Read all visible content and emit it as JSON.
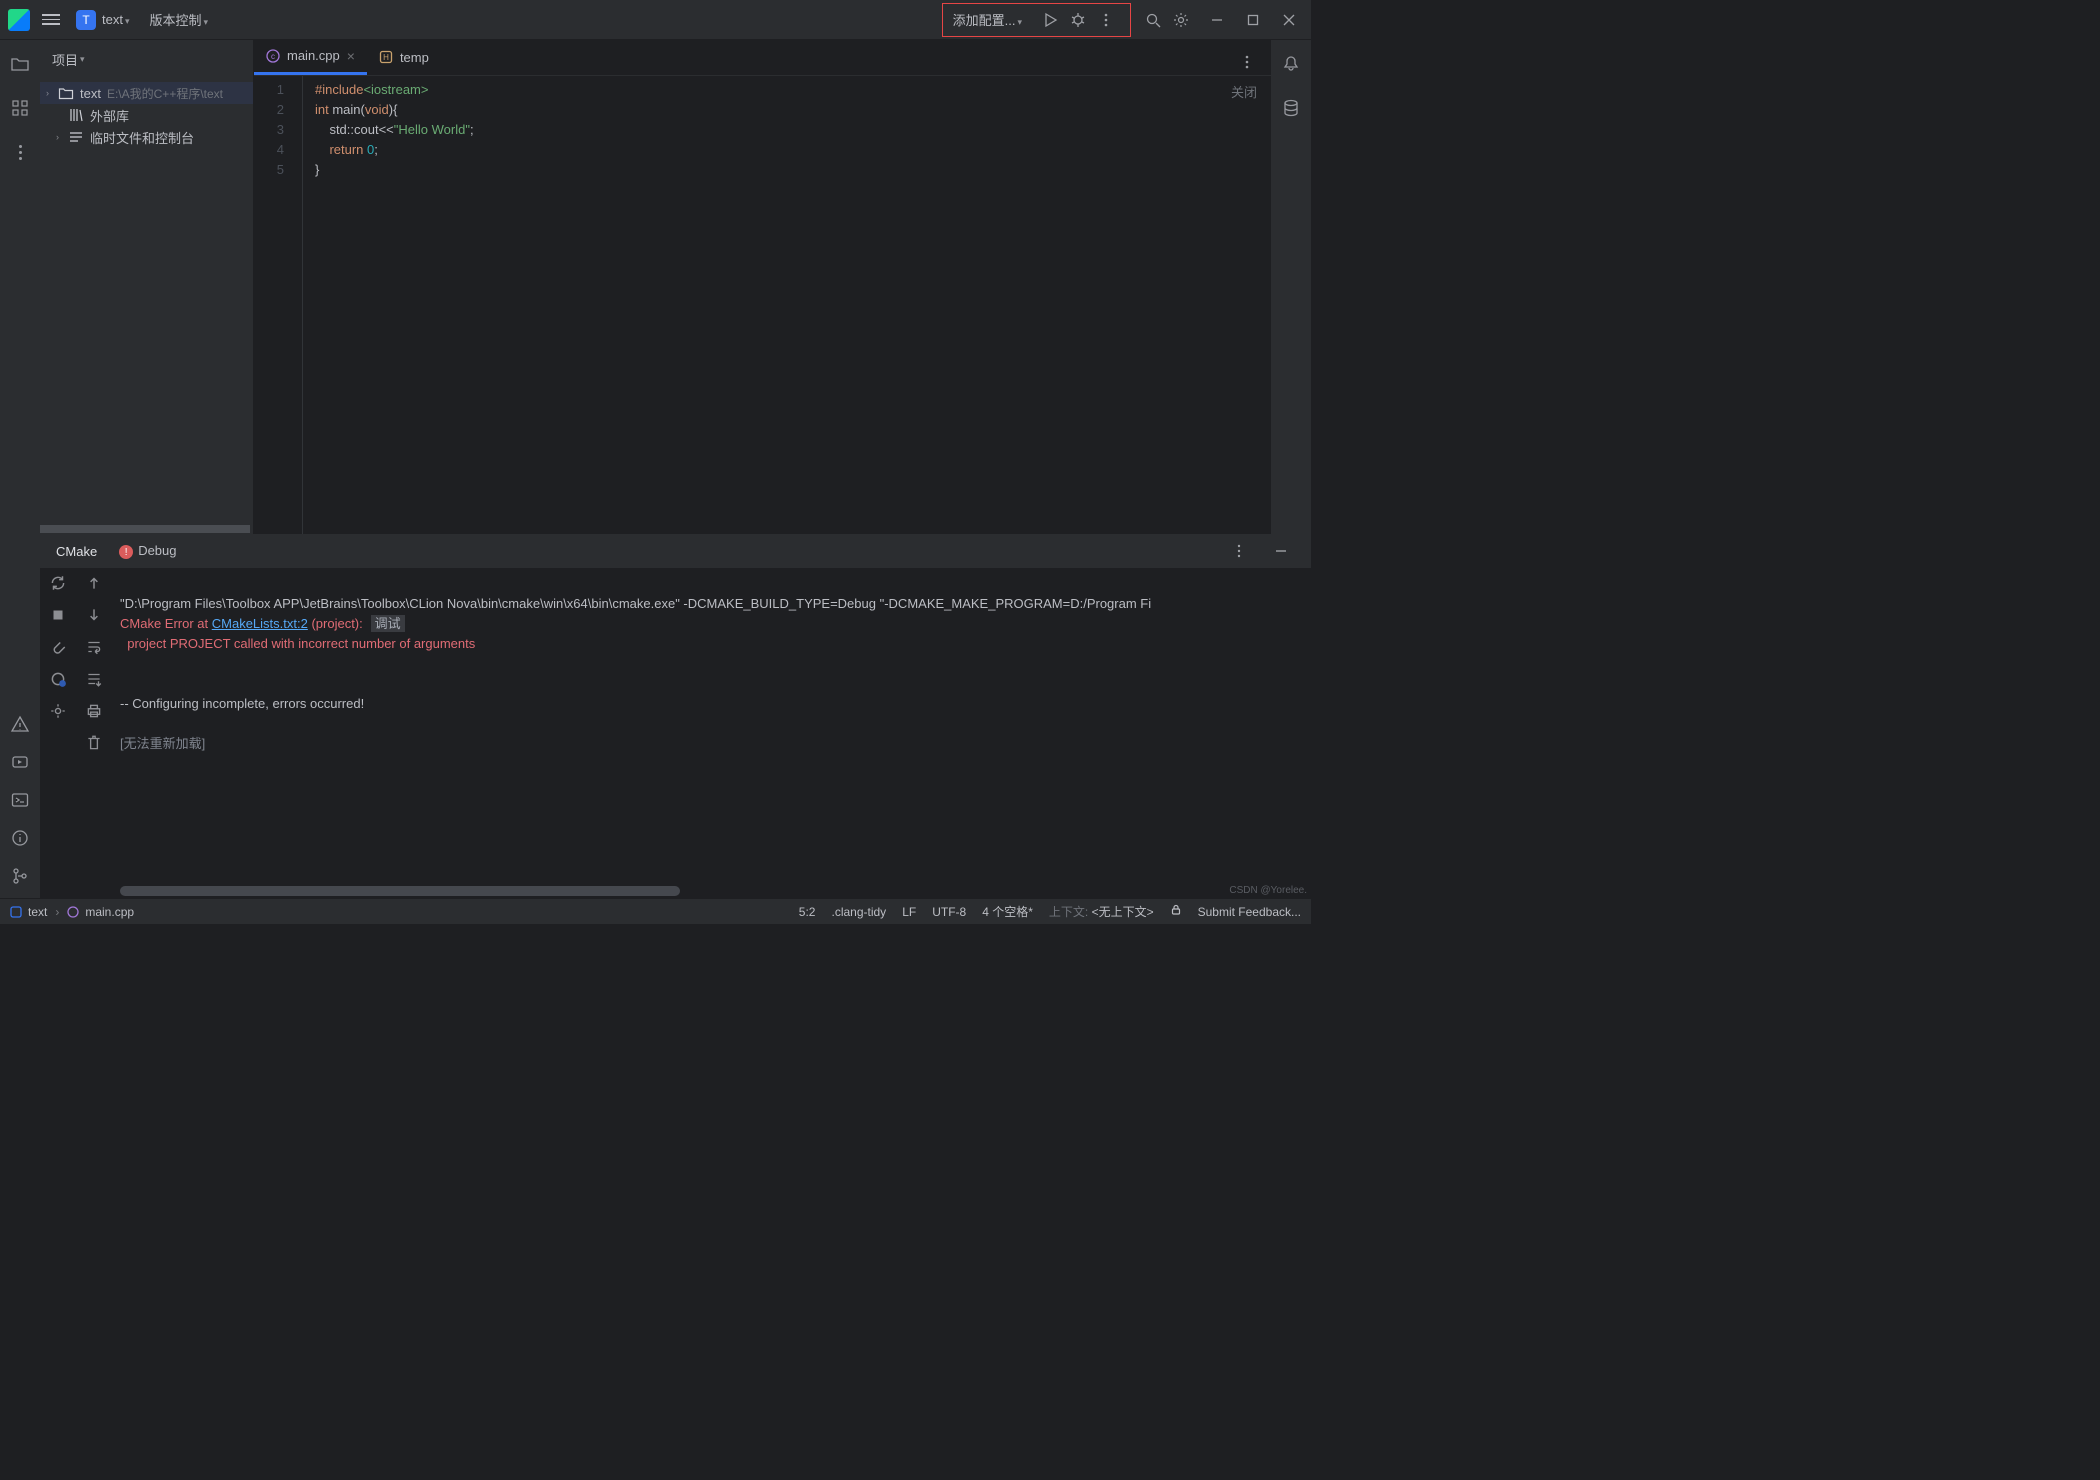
{
  "titlebar": {
    "project_badge": "T",
    "project_name": "text",
    "vcs": "版本控制",
    "run_config": "添加配置..."
  },
  "project_panel": {
    "title": "项目",
    "tree": {
      "root_name": "text",
      "root_path": "E:\\A我的C++程序\\text",
      "ext_libs": "外部库",
      "scratches": "临时文件和控制台"
    }
  },
  "tabs": {
    "main": "main.cpp",
    "temp": "temp"
  },
  "editor": {
    "close": "关闭",
    "line1": {
      "a": "#include",
      "b": "<iostream>"
    },
    "line2": {
      "a": "int ",
      "b": "main",
      "c": "(",
      "d": "void",
      "e": "){"
    },
    "line3": {
      "a": "    std::cout<<",
      "b": "\"Hello World\"",
      "c": ";"
    },
    "line4": {
      "a": "    ",
      "b": "return ",
      "c": "0",
      "d": ";"
    },
    "line5": "}",
    "gutter": [
      "1",
      "2",
      "3",
      "4",
      "5"
    ]
  },
  "toolwindow": {
    "tab_cmake": "CMake",
    "tab_debug": "Debug",
    "console": {
      "l1": "\"D:\\Program Files\\Toolbox APP\\JetBrains\\Toolbox\\CLion Nova\\bin\\cmake\\win\\x64\\bin\\cmake.exe\" -DCMAKE_BUILD_TYPE=Debug \"-DCMAKE_MAKE_PROGRAM=D:/Program Fi",
      "l2_a": "CMake Error at ",
      "l2_link": "CMakeLists.txt:2",
      "l2_b": " (project):",
      "l2_hint": "调试",
      "l3": "  project PROJECT called with incorrect number of arguments",
      "l4": "-- Configuring incomplete, errors occurred!",
      "l5": "[无法重新加载]"
    }
  },
  "breadcrumb": {
    "root": "text",
    "file": "main.cpp",
    "pos": "5:2",
    "tidy": ".clang-tidy",
    "le": "LF",
    "enc": "UTF-8",
    "indent": "4 个空格*",
    "ctx_lbl": "上下文:",
    "ctx_val": "<无上下文>",
    "feedback": "Submit Feedback..."
  },
  "watermark": "CSDN @Yorelee."
}
